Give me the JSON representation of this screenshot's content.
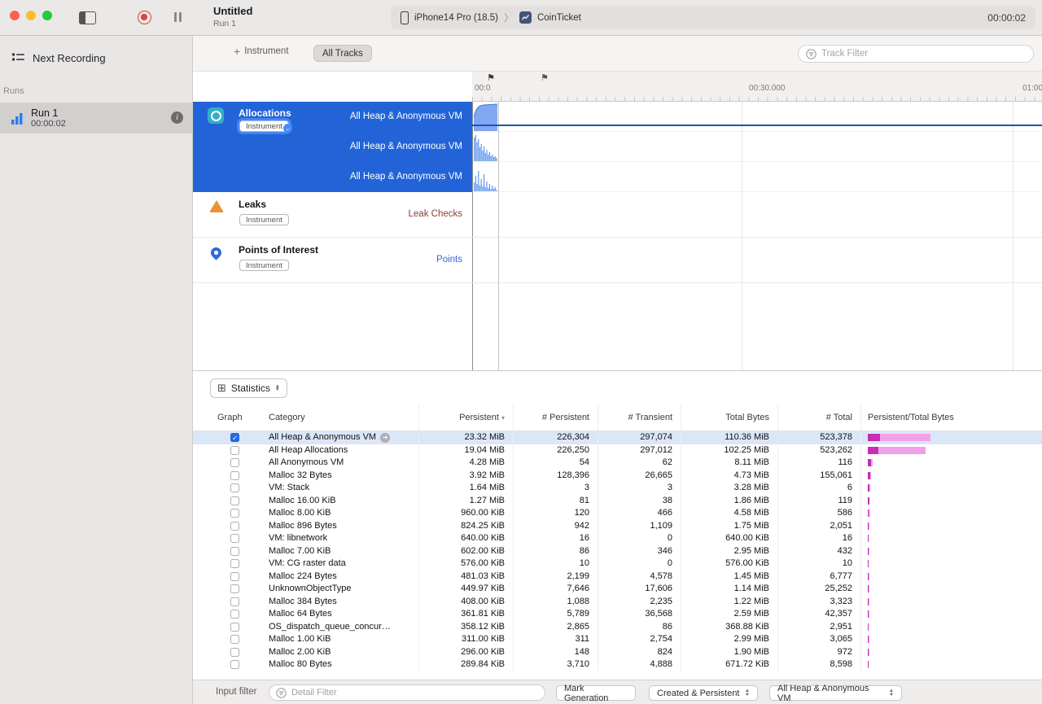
{
  "toolbar": {
    "title": "Untitled",
    "subtitle": "Run 1",
    "device_name": "iPhone14 Pro (18.5)",
    "app_name": "CoinTicket",
    "timer": "00:00:02"
  },
  "sidebar": {
    "next_recording_label": "Next Recording",
    "runs_header": "Runs",
    "run": {
      "name": "Run 1",
      "duration": "00:00:02"
    }
  },
  "track_toolbar": {
    "instrument_button_label": "Instrument",
    "all_tracks_label": "All Tracks",
    "track_filter_placeholder": "Track Filter"
  },
  "timeline": {
    "tick_0": "00:0",
    "tick_30": "00:30.000",
    "tick_60": "01:00"
  },
  "tracks": {
    "allocations": {
      "title": "Allocations",
      "badge": "Instrument",
      "lanes": [
        "All Heap & Anonymous VM",
        "All Heap & Anonymous VM",
        "All Heap & Anonymous VM"
      ]
    },
    "leaks": {
      "title": "Leaks",
      "badge": "Instrument",
      "lane_label": "Leak Checks"
    },
    "points_of_interest": {
      "title": "Points of Interest",
      "badge": "Instrument",
      "lane_label": "Points"
    }
  },
  "statistics": {
    "view_selector_label": "Statistics",
    "columns": [
      "Graph",
      "Category",
      "Persistent",
      "# Persistent",
      "# Transient",
      "Total Bytes",
      "# Total",
      "Persistent/Total Bytes"
    ],
    "rows": [
      {
        "checked": true,
        "selected": true,
        "focus_arrow": true,
        "category": "All Heap & Anonymous VM",
        "persistent": "23.32 MiB",
        "num_persistent": "226,304",
        "num_transient": "297,074",
        "total_bytes": "110.36 MiB",
        "num_total": "523,378",
        "bar": [
          15,
          62
        ]
      },
      {
        "category": "All Heap Allocations",
        "persistent": "19.04 MiB",
        "num_persistent": "226,250",
        "num_transient": "297,012",
        "total_bytes": "102.25 MiB",
        "num_total": "523,262",
        "bar": [
          13,
          58
        ]
      },
      {
        "category": "All Anonymous VM",
        "persistent": "4.28 MiB",
        "num_persistent": "54",
        "num_transient": "62",
        "total_bytes": "8.11 MiB",
        "num_total": "116",
        "bar": [
          4,
          2
        ]
      },
      {
        "category": "Malloc 32 Bytes",
        "persistent": "3.92 MiB",
        "num_persistent": "128,396",
        "num_transient": "26,665",
        "total_bytes": "4.73 MiB",
        "num_total": "155,061",
        "bar": [
          3,
          1
        ]
      },
      {
        "category": "VM: Stack",
        "persistent": "1.64 MiB",
        "num_persistent": "3",
        "num_transient": "3",
        "total_bytes": "3.28 MiB",
        "num_total": "6",
        "bar": [
          2,
          1
        ]
      },
      {
        "category": "Malloc 16.00 KiB",
        "persistent": "1.27 MiB",
        "num_persistent": "81",
        "num_transient": "38",
        "total_bytes": "1.86 MiB",
        "num_total": "119",
        "bar": [
          2,
          0
        ]
      },
      {
        "category": "Malloc 8.00 KiB",
        "persistent": "960.00 KiB",
        "num_persistent": "120",
        "num_transient": "466",
        "total_bytes": "4.58 MiB",
        "num_total": "586",
        "bar": [
          1,
          2
        ]
      },
      {
        "category": "Malloc 896 Bytes",
        "persistent": "824.25 KiB",
        "num_persistent": "942",
        "num_transient": "1,109",
        "total_bytes": "1.75 MiB",
        "num_total": "2,051",
        "bar": [
          1,
          1
        ]
      },
      {
        "category": "VM: libnetwork",
        "persistent": "640.00 KiB",
        "num_persistent": "16",
        "num_transient": "0",
        "total_bytes": "640.00 KiB",
        "num_total": "16",
        "bar": [
          1,
          0
        ]
      },
      {
        "category": "Malloc 7.00 KiB",
        "persistent": "602.00 KiB",
        "num_persistent": "86",
        "num_transient": "346",
        "total_bytes": "2.95 MiB",
        "num_total": "432",
        "bar": [
          1,
          1
        ]
      },
      {
        "category": "VM: CG raster data",
        "persistent": "576.00 KiB",
        "num_persistent": "10",
        "num_transient": "0",
        "total_bytes": "576.00 KiB",
        "num_total": "10",
        "bar": [
          1,
          0
        ]
      },
      {
        "category": "Malloc 224 Bytes",
        "persistent": "481.03 KiB",
        "num_persistent": "2,199",
        "num_transient": "4,578",
        "total_bytes": "1.45 MiB",
        "num_total": "6,777",
        "bar": [
          1,
          1
        ]
      },
      {
        "category": "UnknownObjectType",
        "persistent": "449.97 KiB",
        "num_persistent": "7,646",
        "num_transient": "17,606",
        "total_bytes": "1.14 MiB",
        "num_total": "25,252",
        "bar": [
          1,
          1
        ]
      },
      {
        "category": "Malloc 384 Bytes",
        "persistent": "408.00 KiB",
        "num_persistent": "1,088",
        "num_transient": "2,235",
        "total_bytes": "1.22 MiB",
        "num_total": "3,323",
        "bar": [
          1,
          1
        ]
      },
      {
        "category": "Malloc 64 Bytes",
        "persistent": "361.81 KiB",
        "num_persistent": "5,789",
        "num_transient": "36,568",
        "total_bytes": "2.59 MiB",
        "num_total": "42,357",
        "bar": [
          1,
          1
        ]
      },
      {
        "category": "OS_dispatch_queue_concur…",
        "persistent": "358.12 KiB",
        "num_persistent": "2,865",
        "num_transient": "86",
        "total_bytes": "368.88 KiB",
        "num_total": "2,951",
        "bar": [
          1,
          0
        ]
      },
      {
        "category": "Malloc 1.00 KiB",
        "persistent": "311.00 KiB",
        "num_persistent": "311",
        "num_transient": "2,754",
        "total_bytes": "2.99 MiB",
        "num_total": "3,065",
        "bar": [
          1,
          1
        ]
      },
      {
        "category": "Malloc 2.00 KiB",
        "persistent": "296.00 KiB",
        "num_persistent": "148",
        "num_transient": "824",
        "total_bytes": "1.90 MiB",
        "num_total": "972",
        "bar": [
          1,
          1
        ]
      },
      {
        "category": "Malloc 80 Bytes",
        "persistent": "289.84 KiB",
        "num_persistent": "3,710",
        "num_transient": "4,888",
        "total_bytes": "671.72 KiB",
        "num_total": "8,598",
        "bar": [
          1,
          0
        ]
      }
    ]
  },
  "bottom_bar": {
    "input_filter_label": "Input filter",
    "detail_filter_placeholder": "Detail Filter",
    "mark_generation_label": "Mark Generation",
    "lifecycle_popup_value": "Created & Persistent",
    "scope_popup_value": "All Heap & Anonymous VM"
  },
  "colors": {
    "selection_blue": "#2264d8",
    "persistent_bar": "#c72eb4",
    "transient_bar": "#f2a0e8",
    "leaks_label": "#8d4037",
    "points_label": "#2e6bd6"
  }
}
